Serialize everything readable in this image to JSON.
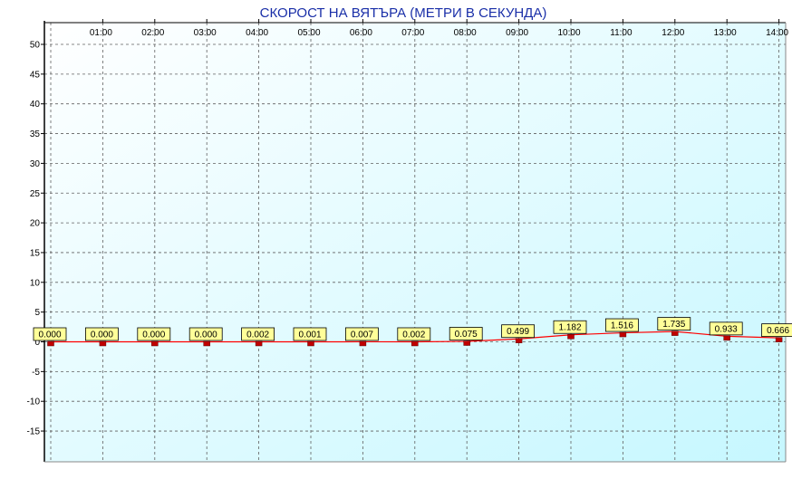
{
  "colors": {
    "plot_bg_top": "#ffffff",
    "plot_bg_bottom": "#c6f7ff",
    "grid": "#606060",
    "line": "#ff0000",
    "marker": "#c00000",
    "label_bg": "#ffff99",
    "title": "#1a2fa8"
  },
  "chart_data": {
    "type": "line",
    "title": "СКОРОСТ НА ВЯТЪРА (МЕТРИ В СЕКУНДА)",
    "xlabel": "",
    "ylabel": "",
    "x_ticks": [
      "01:00",
      "02:00",
      "03:00",
      "04:00",
      "05:00",
      "06:00",
      "07:00",
      "08:00",
      "09:00",
      "10:00",
      "11:00",
      "12:00",
      "13:00",
      "14:00"
    ],
    "y_ticks": [
      "50",
      "45",
      "40",
      "35",
      "30",
      "25",
      "20",
      "15",
      "10",
      "5",
      "0",
      "-5",
      "-10",
      "-15"
    ],
    "ylim": [
      -20,
      50
    ],
    "grid": true,
    "series": [
      {
        "x": [
          "00:00",
          "01:00",
          "02:00",
          "03:00",
          "04:00",
          "05:00",
          "06:00",
          "07:00",
          "08:00",
          "09:00",
          "10:00",
          "11:00",
          "12:00",
          "13:00",
          "14:00"
        ],
        "values": [
          0.0,
          0.0,
          0.0,
          0.0,
          0.002,
          0.001,
          0.007,
          0.002,
          0.075,
          0.499,
          1.182,
          1.516,
          1.735,
          0.933,
          0.666
        ],
        "labels": [
          "0.000",
          "0.000",
          "0.000",
          "0.000",
          "0.002",
          "0.001",
          "0.007",
          "0.002",
          "0.075",
          "0.499",
          "1.182",
          "1.516",
          "1.735",
          "0.933",
          "0.666"
        ]
      }
    ]
  }
}
